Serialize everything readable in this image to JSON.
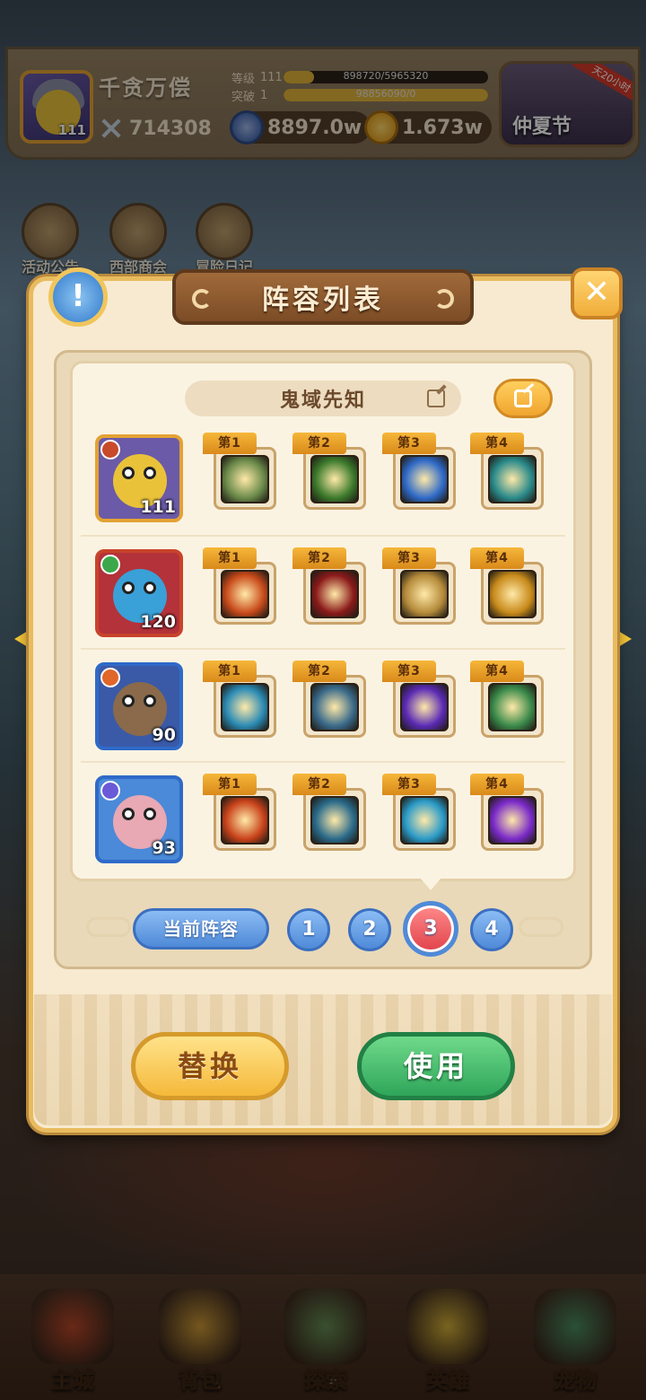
{
  "player": {
    "name": "千贪万偿",
    "avatar_level": "111",
    "power": "714308",
    "level_label": "等级",
    "level": "111",
    "level_exp": "898720/5965320",
    "level_exp_ratio": 0.15,
    "breakthrough_label": "突破",
    "breakthrough": "1",
    "breakthrough_exp": "98856090/0",
    "breakthrough_exp_ratio": 1.0
  },
  "currencies": {
    "diamonds": "8897.0w",
    "gold": "1.673w"
  },
  "event_banner": {
    "label": "仲夏节",
    "tag": "天20小时"
  },
  "shortcuts": [
    {
      "label": "活动公告",
      "icon": "notice-board-icon"
    },
    {
      "label": "西部商会",
      "icon": "merchant-icon"
    },
    {
      "label": "冒险日记",
      "icon": "diary-icon"
    }
  ],
  "dialog": {
    "title": "阵容列表",
    "formation_name": "鬼域先知",
    "info_icon": "info-icon",
    "close_icon": "close-icon",
    "share_icon": "share-icon",
    "edit_icon": "edit-icon"
  },
  "lineup": [
    {
      "hero_level": "111",
      "hero_icon": "armored-duck-hero-icon",
      "element_color": "#c84a2a",
      "frame_color": "#e3a233",
      "bg_color": "#6b5aa8",
      "body_color": "#e9c23a",
      "skills": [
        {
          "tag": "第1",
          "icon": "spiked-club-skill-icon",
          "color": "#6a8a4a"
        },
        {
          "tag": "第2",
          "icon": "golden-shield-skill-icon",
          "color": "#3c7a2c"
        },
        {
          "tag": "第3",
          "icon": "ice-blade-skill-icon",
          "color": "#2f6ac8"
        },
        {
          "tag": "第4",
          "icon": "spirit-skill-icon",
          "color": "#2a8a8a"
        }
      ]
    },
    {
      "hero_level": "120",
      "hero_icon": "skull-fish-hero-icon",
      "element_color": "#3aa84a",
      "frame_color": "#c8432a",
      "bg_color": "#b4323a",
      "body_color": "#3aa0d8",
      "skills": [
        {
          "tag": "第1",
          "icon": "fire-dragon-skill-icon",
          "color": "#c84a1a"
        },
        {
          "tag": "第2",
          "icon": "evil-eye-skill-icon",
          "color": "#8a1a1a"
        },
        {
          "tag": "第3",
          "icon": "demon-claw-skill-icon",
          "color": "#b48a3a"
        },
        {
          "tag": "第4",
          "icon": "golden-serpent-skill-icon",
          "color": "#c88a1a"
        }
      ]
    },
    {
      "hero_level": "90",
      "hero_icon": "rock-golem-hero-icon",
      "element_color": "#e0662a",
      "frame_color": "#2f6ac8",
      "bg_color": "#3a5aa8",
      "body_color": "#8a6a4a",
      "skills": [
        {
          "tag": "第1",
          "icon": "wind-orb-skill-icon",
          "color": "#2a8ab4"
        },
        {
          "tag": "第2",
          "icon": "treant-skill-icon",
          "color": "#3a6a8a"
        },
        {
          "tag": "第3",
          "icon": "void-portal-skill-icon",
          "color": "#5a2ab4"
        },
        {
          "tag": "第4",
          "icon": "peach-plant-skill-icon",
          "color": "#3a8a4a"
        }
      ]
    },
    {
      "hero_level": "93",
      "hero_icon": "frost-knight-hero-icon",
      "element_color": "#6a5ad8",
      "frame_color": "#2f6ac8",
      "bg_color": "#4a8ad8",
      "body_color": "#e8a8b4",
      "skills": [
        {
          "tag": "第1",
          "icon": "flame-fist-skill-icon",
          "color": "#c8421a"
        },
        {
          "tag": "第2",
          "icon": "crimson-mask-skill-icon",
          "color": "#2a6a8a"
        },
        {
          "tag": "第3",
          "icon": "frost-staff-skill-icon",
          "color": "#2a9ac8"
        },
        {
          "tag": "第4",
          "icon": "arcane-burst-skill-icon",
          "color": "#7a2ac8"
        }
      ]
    }
  ],
  "formation_tabs": {
    "current_label": "当前阵容",
    "numbers": [
      "1",
      "2",
      "3",
      "4"
    ],
    "selected": "3"
  },
  "actions": {
    "replace_label": "替换",
    "use_label": "使用"
  },
  "bottom_nav": [
    {
      "label": "主城",
      "icon": "main-city-icon",
      "color": "#c84a2a"
    },
    {
      "label": "背包",
      "icon": "backpack-icon",
      "color": "#e0a83a"
    },
    {
      "label": "探索",
      "icon": "explore-map-icon",
      "color": "#6a9a5a"
    },
    {
      "label": "英雄",
      "icon": "hero-icon",
      "color": "#e8c23a"
    },
    {
      "label": "宠物",
      "icon": "pet-icon",
      "color": "#4a9a6a"
    }
  ]
}
